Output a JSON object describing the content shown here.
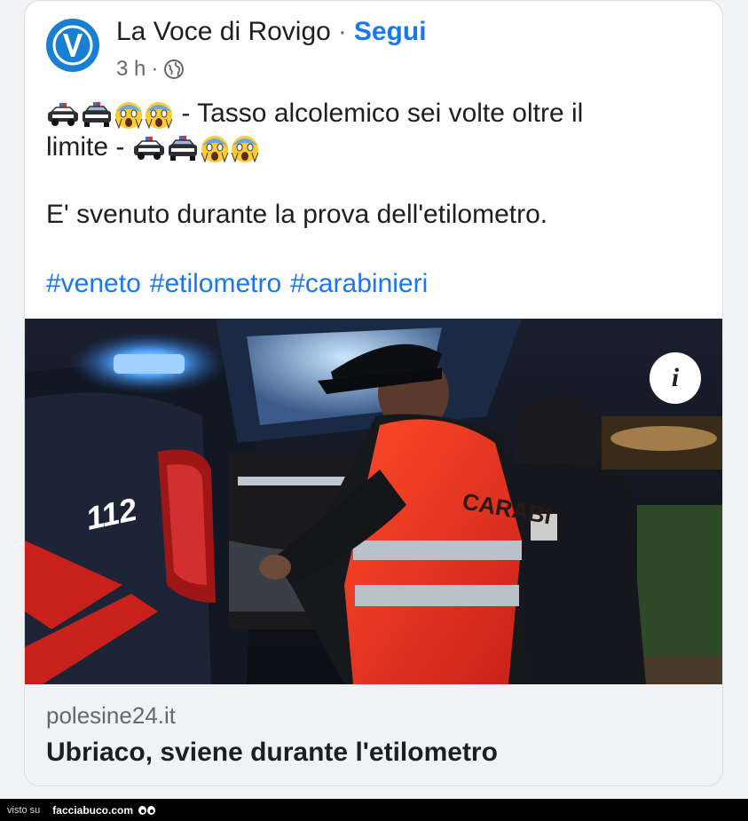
{
  "post": {
    "page_name": "La Voce di Rovigo",
    "separator": "·",
    "follow_label": "Segui",
    "time": "3 h",
    "dot": "·",
    "line1_text": " - Tasso alcolemico sei volte oltre il",
    "line2_text": "limite - ",
    "line3_text": "E' svenuto durante la prova dell'etilometro.",
    "hashtags": [
      "#veneto",
      "#etilometro",
      "#carabinieri"
    ]
  },
  "photo": {
    "info_label": "i",
    "car_number": "112",
    "vest_text": "CARABI"
  },
  "link": {
    "domain": "polesine24.it",
    "title": "Ubriaco, sviene durante l'etilometro"
  },
  "footer": {
    "visto": "visto su",
    "site": "facciabuco.com"
  },
  "icons": {
    "globe": "globe-icon",
    "police_car": "police-car-emoji",
    "scream": "scream-emoji"
  },
  "colors": {
    "link_blue": "#1877f2",
    "text": "#1c1e21",
    "muted": "#65676b"
  }
}
